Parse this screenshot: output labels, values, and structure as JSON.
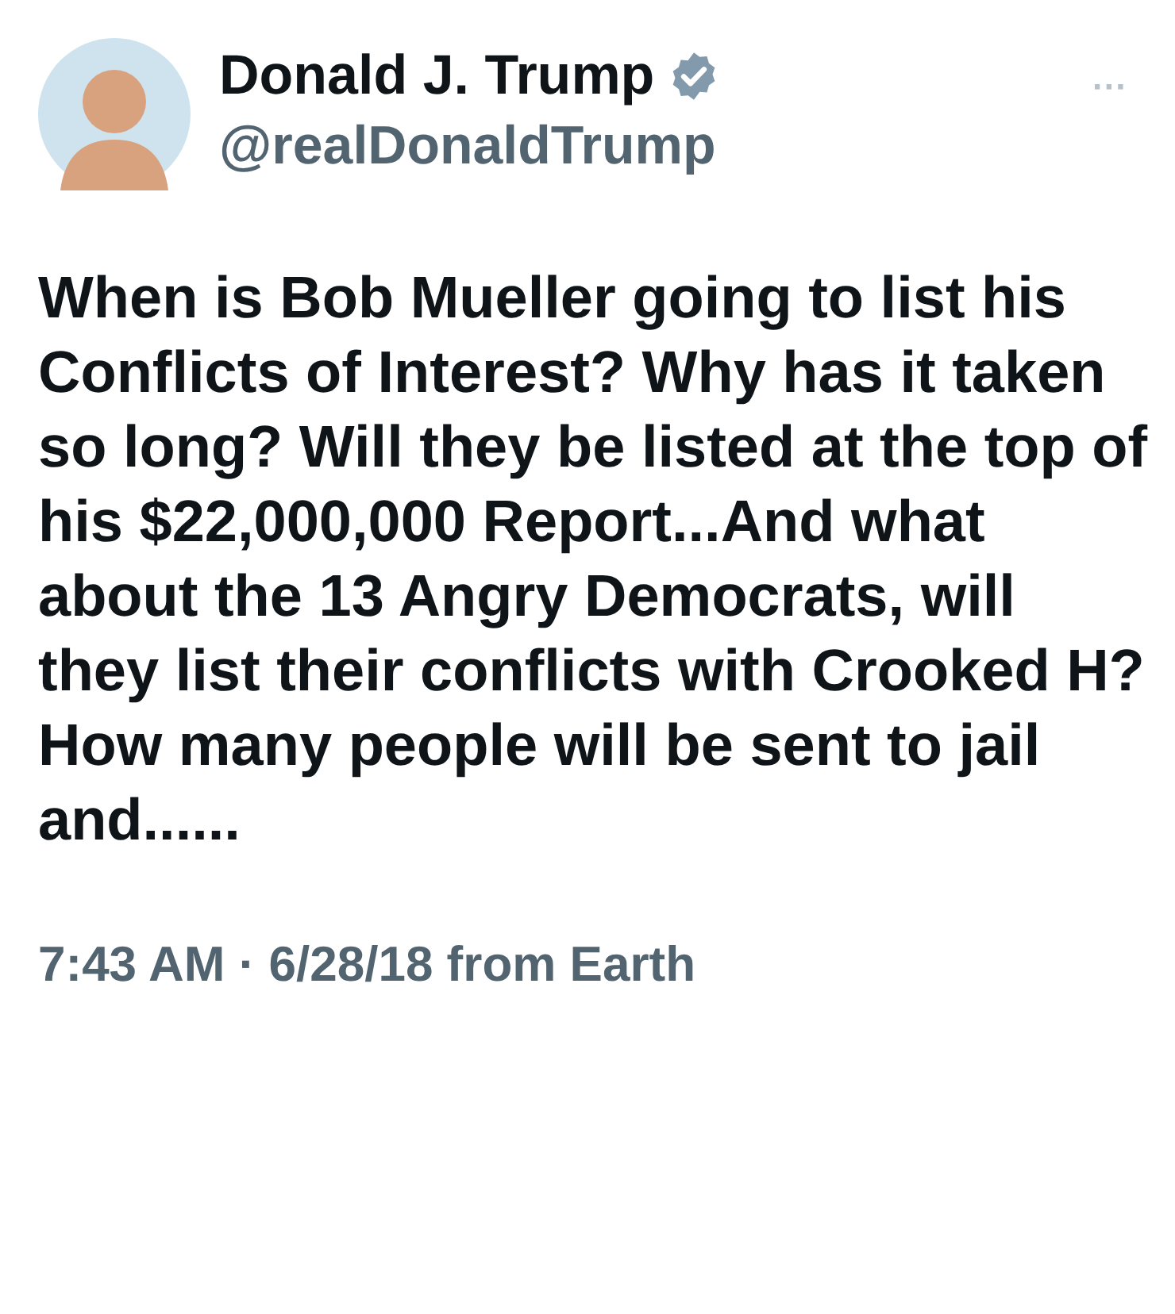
{
  "author": {
    "name": "Donald J. Trump",
    "verified": true,
    "handle": "@realDonaldTrump"
  },
  "more_button": "···",
  "body": "When is Bob Mueller going to list his Conflicts of Interest? Why has it taken so long? Will they be listed at the top of his $22,000,000 Report...And what about the 13 Angry Democrats, will they list their conflicts with Crooked H? How many people will be sent to jail and......",
  "timestamp": "7:43 AM · 6/28/18 from Earth"
}
